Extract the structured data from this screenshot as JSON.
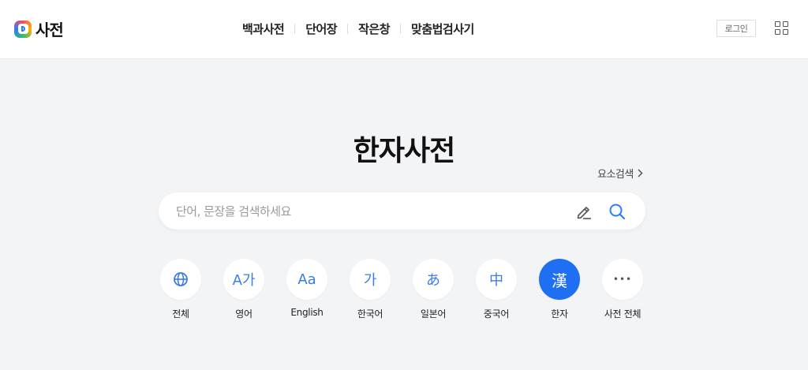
{
  "header": {
    "logo_text": "사전",
    "nav": [
      "백과사전",
      "단어장",
      "작은창",
      "맞춤법검사기"
    ],
    "login_label": "로그인"
  },
  "main": {
    "title": "한자사전",
    "element_search_label": "요소검색",
    "search": {
      "placeholder": "단어, 문장을 검색하세요",
      "value": ""
    }
  },
  "categories": [
    {
      "label": "전체",
      "icon": "globe-icon",
      "glyph": ""
    },
    {
      "label": "영어",
      "icon": "english-icon",
      "glyph": "A가"
    },
    {
      "label": "English",
      "icon": "english-english-icon",
      "glyph": "Aa"
    },
    {
      "label": "한국어",
      "icon": "korean-icon",
      "glyph": "가"
    },
    {
      "label": "일본어",
      "icon": "japanese-icon",
      "glyph": "あ"
    },
    {
      "label": "중국어",
      "icon": "chinese-icon",
      "glyph": "中"
    },
    {
      "label": "한자",
      "icon": "hanja-icon",
      "glyph": "漢",
      "active": true
    },
    {
      "label": "사전 전체",
      "icon": "more-icon",
      "glyph": "•••"
    }
  ],
  "colors": {
    "accent": "#1f6ff2",
    "icon_blue": "#3b7ce6",
    "background": "#f3f4f6"
  }
}
